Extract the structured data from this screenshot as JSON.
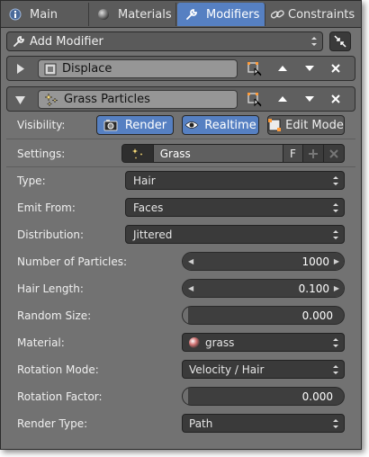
{
  "tabs": [
    {
      "label": "Main",
      "icon": "info-icon"
    },
    {
      "label": "Materials",
      "icon": "material-sphere-icon"
    },
    {
      "label": "Modifiers",
      "icon": "wrench-icon"
    },
    {
      "label": "Constraints",
      "icon": "chain-link-icon"
    }
  ],
  "add_modifier": {
    "label": "Add Modifier"
  },
  "modifiers": [
    {
      "name": "Displace",
      "expanded": false
    },
    {
      "name": "Grass Particles",
      "expanded": true
    }
  ],
  "visibility": {
    "label": "Visibility:",
    "render": "Render",
    "realtime": "Realtime",
    "edit_mode": "Edit Mode"
  },
  "settings": {
    "label": "Settings:",
    "value": "Grass",
    "fake_user": "F"
  },
  "props": [
    {
      "label": "Type:",
      "value": "Hair"
    },
    {
      "label": "Emit From:",
      "value": "Faces"
    },
    {
      "label": "Distribution:",
      "value": "Jittered"
    },
    {
      "label": "Number of Particles:",
      "value": "1000",
      "fraction": 1.0
    },
    {
      "label": "Hair Length:",
      "value": "0.100",
      "fraction": 1.0
    },
    {
      "label": "Random Size:",
      "value": "0.000",
      "fraction": 0.0
    },
    {
      "label": "Material:",
      "value": "grass"
    },
    {
      "label": "Rotation Mode:",
      "value": "Velocity / Hair"
    },
    {
      "label": "Rotation Factor:",
      "value": "0.000",
      "fraction": 0.0
    },
    {
      "label": "Render Type:",
      "value": "Path"
    }
  ],
  "colors": {
    "accent": "#5680c2",
    "panel": "#727272",
    "field": "#3a3a3a"
  }
}
